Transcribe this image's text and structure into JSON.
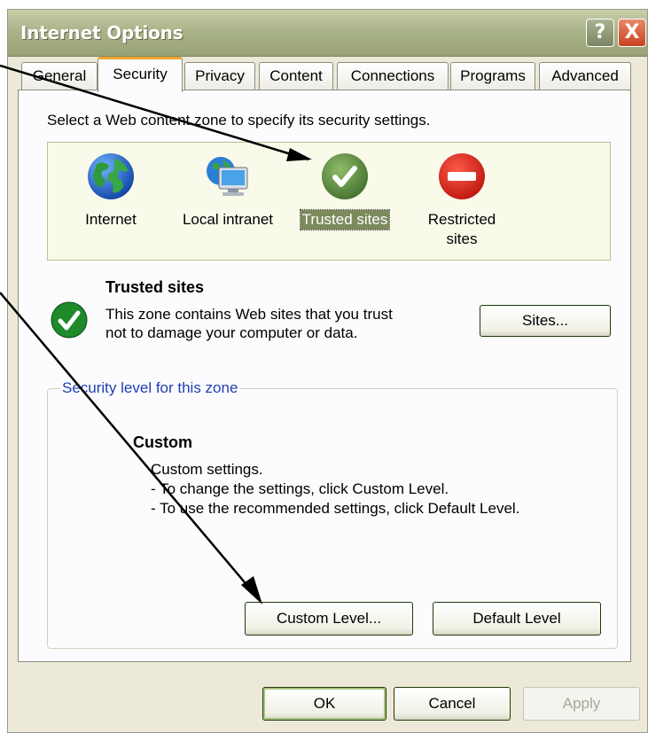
{
  "window": {
    "title": "Internet Options",
    "help_label": "?",
    "close_label": "X"
  },
  "tabs": [
    {
      "label": "General",
      "active": false
    },
    {
      "label": "Security",
      "active": true
    },
    {
      "label": "Privacy",
      "active": false
    },
    {
      "label": "Content",
      "active": false
    },
    {
      "label": "Connections",
      "active": false
    },
    {
      "label": "Programs",
      "active": false
    },
    {
      "label": "Advanced",
      "active": false
    }
  ],
  "security": {
    "zone_instruction": "Select a Web content zone to specify its security settings.",
    "zones": [
      {
        "label": "Internet",
        "icon": "globe-icon"
      },
      {
        "label": "Local intranet",
        "icon": "intranet-icon"
      },
      {
        "label": "Trusted sites",
        "icon": "check-circle-icon",
        "selected": true
      },
      {
        "label": "Restricted sites",
        "icon": "no-entry-icon"
      }
    ],
    "selected_zone": {
      "title": "Trusted sites",
      "description": "This zone contains Web sites that you trust not to damage your computer or data.",
      "sites_button": "Sites..."
    },
    "level_group": {
      "legend": "Security level for this zone",
      "level_title": "Custom",
      "desc_line1": "Custom settings.",
      "desc_line2": "- To change the settings, click Custom Level.",
      "desc_line3": "- To use the recommended settings, click Default Level.",
      "custom_level_button": "Custom Level...",
      "default_level_button": "Default Level"
    }
  },
  "footer": {
    "ok": "OK",
    "cancel": "Cancel",
    "apply": "Apply"
  },
  "colors": {
    "titlebar": "#aab38a",
    "active_tab_accent": "#f0a330",
    "selected_zone": "#7c8a5c",
    "legend_text": "#1f3fb0"
  }
}
